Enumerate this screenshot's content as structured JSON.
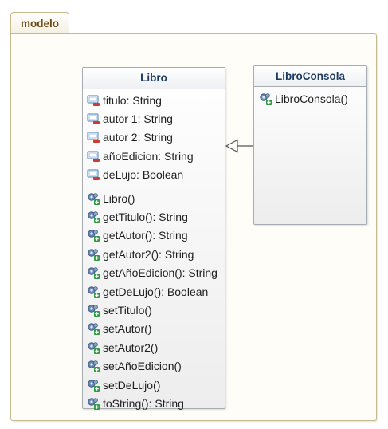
{
  "package": {
    "name": "modelo"
  },
  "classes": {
    "libro": {
      "name": "Libro",
      "attributes": [
        "titulo: String",
        "autor 1: String",
        "autor 2: String",
        "añoEdicion: String",
        "deLujo: Boolean"
      ],
      "operations": [
        "Libro()",
        "getTitulo(): String",
        "getAutor(): String",
        "getAutor2(): String",
        "getAñoEdicion(): String",
        "getDeLujo(): Boolean",
        "setTitulo()",
        "setAutor()",
        "setAutor2()",
        "setAñoEdicion()",
        "setDeLujo()",
        "toString(): String"
      ]
    },
    "libroconsola": {
      "name": "LibroConsola",
      "operations": [
        "LibroConsola()"
      ]
    }
  },
  "relationship": {
    "type": "generalization",
    "from": "LibroConsola",
    "to": "Libro"
  },
  "colors": {
    "package_border": "#c6b98c",
    "package_title": "#6b4a14",
    "class_title": "#1b3a5f",
    "class_border": "#a7acb3"
  }
}
